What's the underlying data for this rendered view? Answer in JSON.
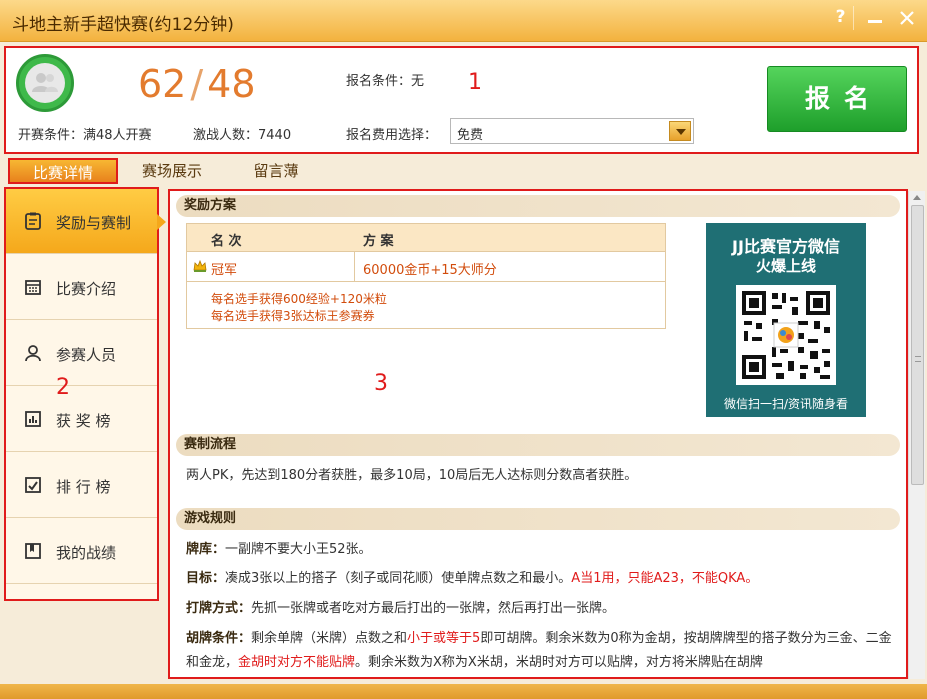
{
  "window": {
    "title": "斗地主新手超快赛(约12分钟)",
    "help_label": "?"
  },
  "info": {
    "count_current": "62",
    "count_sep": "/",
    "count_total": "48",
    "open_condition": "开赛条件：满48人开赛",
    "fighters": "激战人数：7440",
    "signup_condition": "报名条件：无",
    "fee_label": "报名费用选择：",
    "fee_value": "免费",
    "signup_button": "报名"
  },
  "annotations": {
    "m1": "1",
    "m2": "2",
    "m3": "3"
  },
  "tabs": [
    {
      "label": "比赛详情"
    },
    {
      "label": "赛场展示"
    },
    {
      "label": "留言薄"
    }
  ],
  "sidebar": {
    "items": [
      {
        "label": "奖励与赛制",
        "icon": "clipboard-icon"
      },
      {
        "label": "比赛介绍",
        "icon": "calendar-icon"
      },
      {
        "label": "参赛人员",
        "icon": "user-icon"
      },
      {
        "label": "获 奖 榜",
        "icon": "bar-chart-icon"
      },
      {
        "label": "排 行 榜",
        "icon": "trend-icon"
      },
      {
        "label": "我的战绩",
        "icon": "bookmark-icon"
      }
    ]
  },
  "rewards": {
    "header": "奖励方案",
    "col_rank": "名 次",
    "col_plan": "方 案",
    "rows": [
      {
        "rank": "冠军",
        "prize": "60000金币+15大师分"
      }
    ],
    "extra_1": "每名选手获得600经验+120米粒",
    "extra_2": "每名选手获得3张达标王参赛券"
  },
  "qr": {
    "title": "JJ比赛官方微信",
    "subtitle": "火爆上线",
    "caption": "微信扫一扫/资讯随身看"
  },
  "process": {
    "header": "赛制流程",
    "text": "两人PK，先达到180分者获胜，最多10局，10局后无人达标则分数高者获胜。"
  },
  "rules": {
    "header": "游戏规则",
    "deck_label": "牌库：",
    "deck_text": "一副牌不要大小王52张。",
    "goal_label": "目标：",
    "goal_text": "凑成3张以上的搭子（刻子或同花顺）使单牌点数之和最小。",
    "goal_red": "A当1用，只能A23，不能QKA。",
    "play_label": "打牌方式：",
    "play_text": "先抓一张牌或者吃对方最后打出的一张牌，然后再打出一张牌。",
    "hu_label": "胡牌条件：",
    "hu_text_1": "剩余单牌（米牌）点数之和",
    "hu_red_1": "小于或等于5",
    "hu_text_2": "即可胡牌。剩余米数为0称为金胡，按胡牌牌型的搭子数分为三金、二金和金龙，",
    "hu_red_2": "金胡时对方不能贴牌",
    "hu_text_3": "。剩余米数为X称为X米胡，米胡时对方可以贴牌，对方将米牌贴在胡牌"
  },
  "colors": {
    "accent": "#f5a81b",
    "signup": "#2db83a",
    "annotation": "#e01b1b",
    "highlight_text": "#d24c0c"
  }
}
